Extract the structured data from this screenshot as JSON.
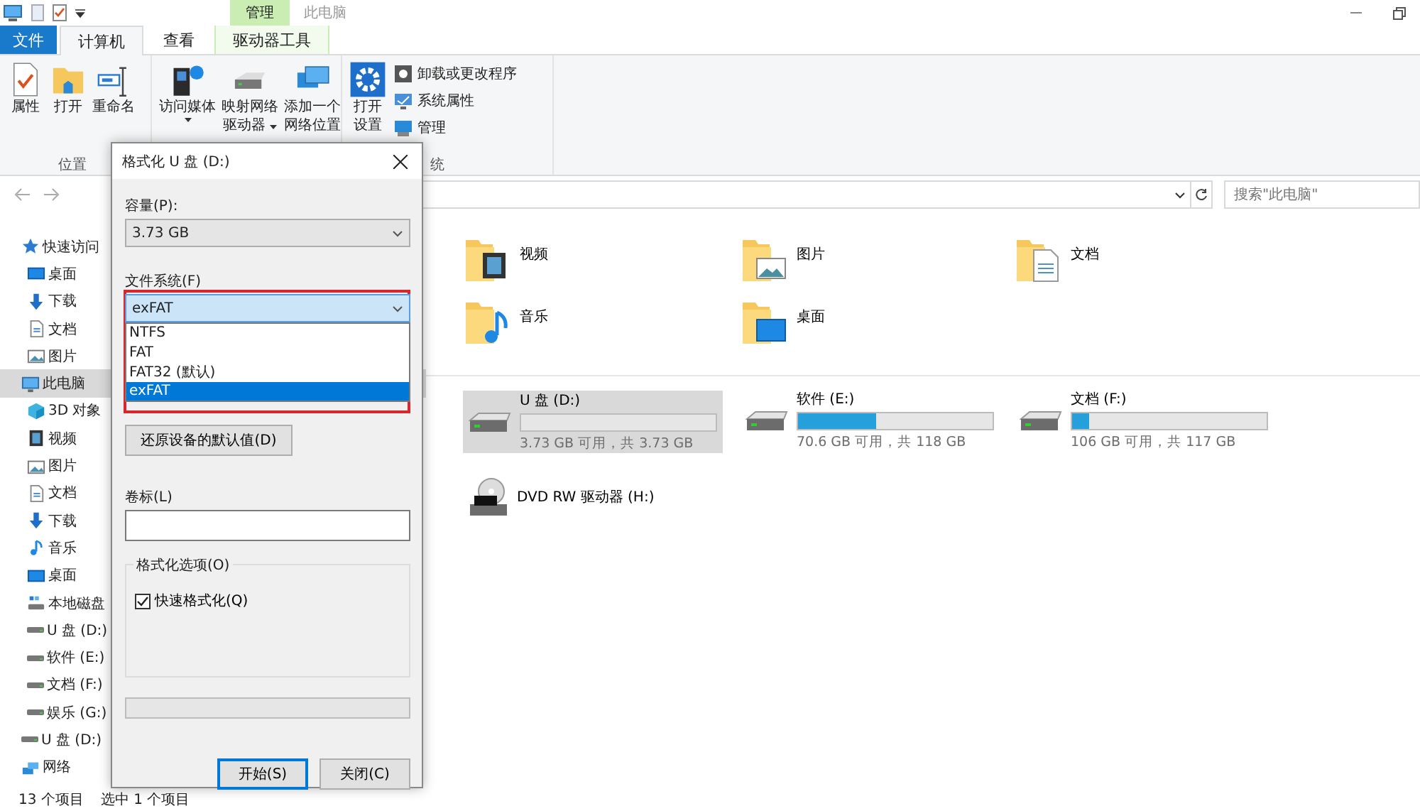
{
  "window": {
    "title": "此电脑",
    "context_group": "管理"
  },
  "tabs": [
    {
      "label": "文件",
      "kind": "menu",
      "selected": false
    },
    {
      "label": "计算机",
      "kind": "tab",
      "selected": true
    },
    {
      "label": "查看",
      "kind": "tab",
      "selected": false
    },
    {
      "label": "驱动器工具",
      "kind": "context",
      "selected": false
    }
  ],
  "ribbon": {
    "groups": [
      {
        "label": "位置",
        "commands": [
          {
            "lines": [
              "属性"
            ],
            "kind": "large"
          },
          {
            "lines": [
              "打开"
            ],
            "kind": "large"
          },
          {
            "lines": [
              "重命名"
            ],
            "kind": "large"
          }
        ]
      },
      {
        "commands": [
          {
            "lines": [
              "访问媒体"
            ],
            "kind": "large",
            "dropdown": true
          },
          {
            "lines": [
              "映射网络",
              "驱动器"
            ],
            "kind": "large",
            "dropdown": true
          },
          {
            "lines": [
              "添加一个",
              "网络位置"
            ],
            "kind": "large"
          }
        ]
      },
      {
        "label": "统",
        "commands": [
          {
            "lines": [
              "打开",
              "设置"
            ],
            "kind": "large"
          },
          {
            "lines": [
              "卸载或更改程序"
            ],
            "kind": "small"
          },
          {
            "lines": [
              "系统属性"
            ],
            "kind": "small"
          },
          {
            "lines": [
              "管理"
            ],
            "kind": "small"
          }
        ]
      }
    ]
  },
  "address_bar": {
    "search_placeholder": "搜索\"此电脑\""
  },
  "sidebar": {
    "items": [
      {
        "label": "快速访问",
        "kind": "star",
        "selected": false,
        "children": [
          {
            "label": "桌面",
            "kind": "desktop",
            "selected": false
          },
          {
            "label": "下载",
            "kind": "download",
            "selected": false
          },
          {
            "label": "文档",
            "kind": "document",
            "selected": false
          },
          {
            "label": "图片",
            "kind": "picture",
            "selected": false
          }
        ]
      },
      {
        "label": "此电脑",
        "kind": "computer",
        "selected": true,
        "children": [
          {
            "label": "3D 对象",
            "kind": "cube",
            "selected": false
          },
          {
            "label": "视频",
            "kind": "video",
            "selected": false
          },
          {
            "label": "图片",
            "kind": "picture",
            "selected": false
          },
          {
            "label": "文档",
            "kind": "document",
            "selected": false
          },
          {
            "label": "下载",
            "kind": "download",
            "selected": false
          },
          {
            "label": "音乐",
            "kind": "music",
            "selected": false
          },
          {
            "label": "桌面",
            "kind": "desktop",
            "selected": false
          },
          {
            "label": "本地磁盘",
            "kind": "system",
            "selected": false
          },
          {
            "label": "U 盘 (D:)",
            "kind": "disk",
            "selected": false
          },
          {
            "label": "软件 (E:)",
            "kind": "disk",
            "selected": false
          },
          {
            "label": "文档 (F:)",
            "kind": "disk",
            "selected": false
          },
          {
            "label": "娱乐 (G:)",
            "kind": "disk",
            "selected": false
          }
        ]
      },
      {
        "label": "U 盘 (D:)",
        "kind": "disk",
        "selected": false
      },
      {
        "label": "网络",
        "kind": "network",
        "selected": false
      }
    ]
  },
  "folders": [
    {
      "name": "视频",
      "kind": "video"
    },
    {
      "name": "图片",
      "kind": "picture"
    },
    {
      "name": "文档",
      "kind": "document"
    },
    {
      "name": "音乐",
      "kind": "music"
    },
    {
      "name": "桌面",
      "kind": "desktop"
    }
  ],
  "drives": [
    {
      "name": "U 盘 (D:)",
      "kind": "disk",
      "selected": true,
      "free": "3.73 GB 可用，共 3.73 GB"
    },
    {
      "name": "软件 (E:)",
      "kind": "disk",
      "selected": false,
      "level": 0.4,
      "free": "70.6 GB 可用，共 118 GB"
    },
    {
      "name": "文档 (F:)",
      "kind": "disk",
      "selected": false,
      "level": 0.09,
      "free": "106 GB 可用，共 117 GB"
    },
    {
      "name": "DVD RW 驱动器 (H:)",
      "kind": "dvd",
      "selected": false
    }
  ],
  "status_bar": [
    "13 个项目",
    "选中 1 个项目"
  ],
  "dialog": {
    "title": "格式化 U 盘 (D:)",
    "capacity": {
      "label": "容量(P):",
      "value": "3.73 GB"
    },
    "file_system": {
      "label": "文件系统(F)",
      "value": "exFAT",
      "expanded": true,
      "options": [
        {
          "label": "NTFS",
          "selected": false
        },
        {
          "label": "FAT",
          "selected": false
        },
        {
          "label": "FAT32 (默认)",
          "selected": false
        },
        {
          "label": "exFAT",
          "selected": true
        }
      ]
    },
    "restore_button": "还原设备的默认值(D)",
    "volume_label": {
      "label": "卷标(L)"
    },
    "options_group": {
      "label": "格式化选项(O)",
      "quick_format": {
        "label": "快速格式化(Q)",
        "checked": true
      }
    },
    "buttons": [
      {
        "label": "开始(S)",
        "kind": "default"
      },
      {
        "label": "关闭(C)",
        "kind": "normal"
      }
    ]
  }
}
